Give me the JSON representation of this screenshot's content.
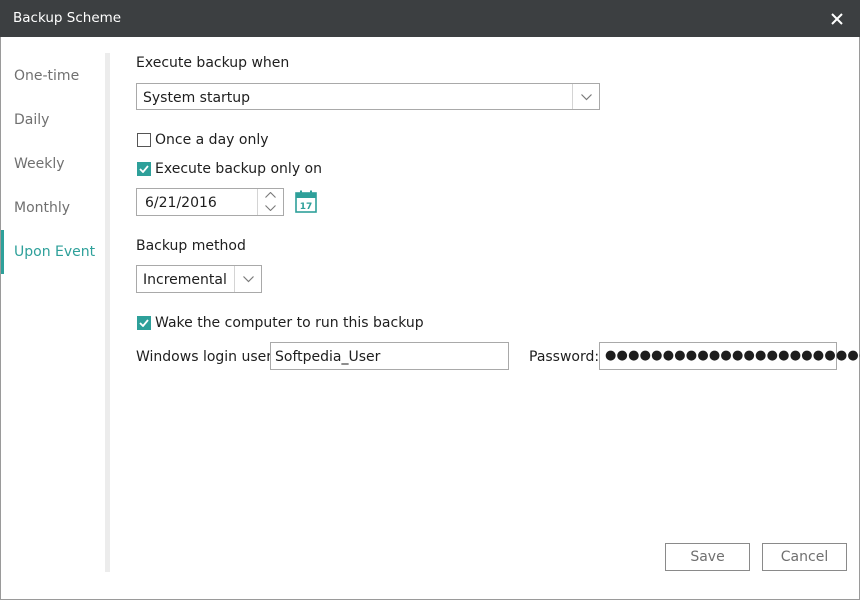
{
  "window": {
    "title": "Backup Scheme"
  },
  "sidebar": {
    "items": [
      {
        "label": "One-time"
      },
      {
        "label": "Daily"
      },
      {
        "label": "Weekly"
      },
      {
        "label": "Monthly"
      },
      {
        "label": "Upon Event",
        "active": true
      }
    ]
  },
  "execute": {
    "heading": "Execute backup when",
    "event_selected": "System startup"
  },
  "once_a_day": {
    "label": "Once a day only",
    "checked": false
  },
  "execute_only_on": {
    "label": "Execute backup only on",
    "checked": true,
    "date": "6/21/2016"
  },
  "calendar_icon": {
    "day": "17"
  },
  "method": {
    "heading": "Backup method",
    "selected": "Incremental"
  },
  "wake": {
    "label": "Wake the computer to run this backup",
    "checked": true
  },
  "login": {
    "user_label": "Windows login user:",
    "user_value": "Softpedia_User",
    "password_label": "Password:",
    "password_mask": "●●●●●●●●●●●●●●●●●●●●●●●"
  },
  "buttons": {
    "save": "Save",
    "cancel": "Cancel"
  },
  "colors": {
    "accent": "#2ea09a",
    "titlebar": "#3c3f41"
  }
}
